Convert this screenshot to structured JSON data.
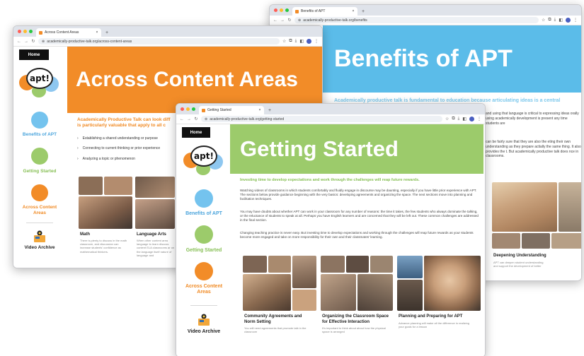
{
  "windows": {
    "benefits": {
      "tab_title": "Benefits of APT",
      "url": "academically-productive-talk.org/benefits",
      "hero_title": "Benefits of APT",
      "intro": "Academically productive talk is fundamental to education because articulating ideas is a central",
      "right_paragraph_1": "and using that language is critical to expressing ideas orally using academically development is present any time students are",
      "right_paragraph_2": "can be fairly sure that they are also the eting their own understanding as they prepare actially the same thing. It also provides the t. But academically productive talk does nce in classrooms.",
      "card_title": "Deepening Understanding",
      "card_sub": "APT can deepen student understanding and support the development of better"
    },
    "content": {
      "tab_title": "Across Content Areas",
      "url": "academically-productive-talk.org/across-content-areas",
      "home_label": "Home",
      "logo_text": "apt!",
      "hero_title": "Across Content Areas",
      "intro_line1": "Academically Productive Talk can look diff",
      "intro_line2": "is particularly valuable that apply to all c",
      "bullets": [
        "Establishing a shared understanding or purpose",
        "Connecting to current thinking or prior experience",
        "Analyzing a topic or phenomenon"
      ],
      "nav": {
        "benefits": "Benefits of APT",
        "getting_started": "Getting Started",
        "across_line1": "Across Content",
        "across_line2": "Areas",
        "video": "Video Archive"
      },
      "cards": [
        {
          "title": "Math",
          "sub": "There is plenty to discuss in the math classroom, and discussion can increase students' confidence as mathematical thinkers."
        },
        {
          "title": "Language Arts",
          "sub": "When other content area language to learn discuss content ELA classrooms ar on the language itself nature of language and"
        }
      ]
    },
    "started": {
      "tab_title": "Getting Started",
      "url": "academically-productive-talk.org/getting-started",
      "home_label": "Home",
      "logo_text": "apt!",
      "hero_title": "Getting Started",
      "intro": "Investing time to develop expectations and work through the challenges will reap future rewards.",
      "paragraphs": [
        "Watching videos of classrooms in which students comfortably and fluidly engage in discourse may be daunting, especially if you have little prior experience with APT. The sections below provide guidance beginning with the very basics: developing agreements and organizing the space. The next sections move into planning and facilitation techniques.",
        "You may have doubts about whether APT can work in your classroom for any number of reasons: the time it takes, the few students who always dominate the talking, or the reluctance of students to speak at all. Perhaps you have English learners and are concerned that they will be left out. These common challenges are addressed in the final section.",
        "Changing teaching practice is never easy. But investing time to develop expectations and working through the challenges will reap future rewards as your students become more engaged and take on more responsibility for their own and their classmates' learning."
      ],
      "nav": {
        "benefits": "Benefits of APT",
        "getting_started": "Getting Started",
        "across_line1": "Across Content",
        "across_line2": "Areas",
        "video": "Video Archive"
      },
      "cards": [
        {
          "title_line1": "Community Agreements and",
          "title_line2": "Norm Setting",
          "sub": "You will need agreements that promote talk in the classroom"
        },
        {
          "title_line1": "Organizing the Classroom Space",
          "title_line2": "for Effective Interaction",
          "sub": "It's important to think about about how the physical space is arranged"
        },
        {
          "title_line1": "Planning and Preparing for APT",
          "title_line2": "",
          "sub": "Advance planning will make all the difference in realizing your goals for a lesson"
        }
      ]
    }
  },
  "colors": {
    "orange": "#f28c28",
    "green": "#9ccb6b",
    "blue": "#74c3ee",
    "benefits_banner": "#5bbce9"
  }
}
